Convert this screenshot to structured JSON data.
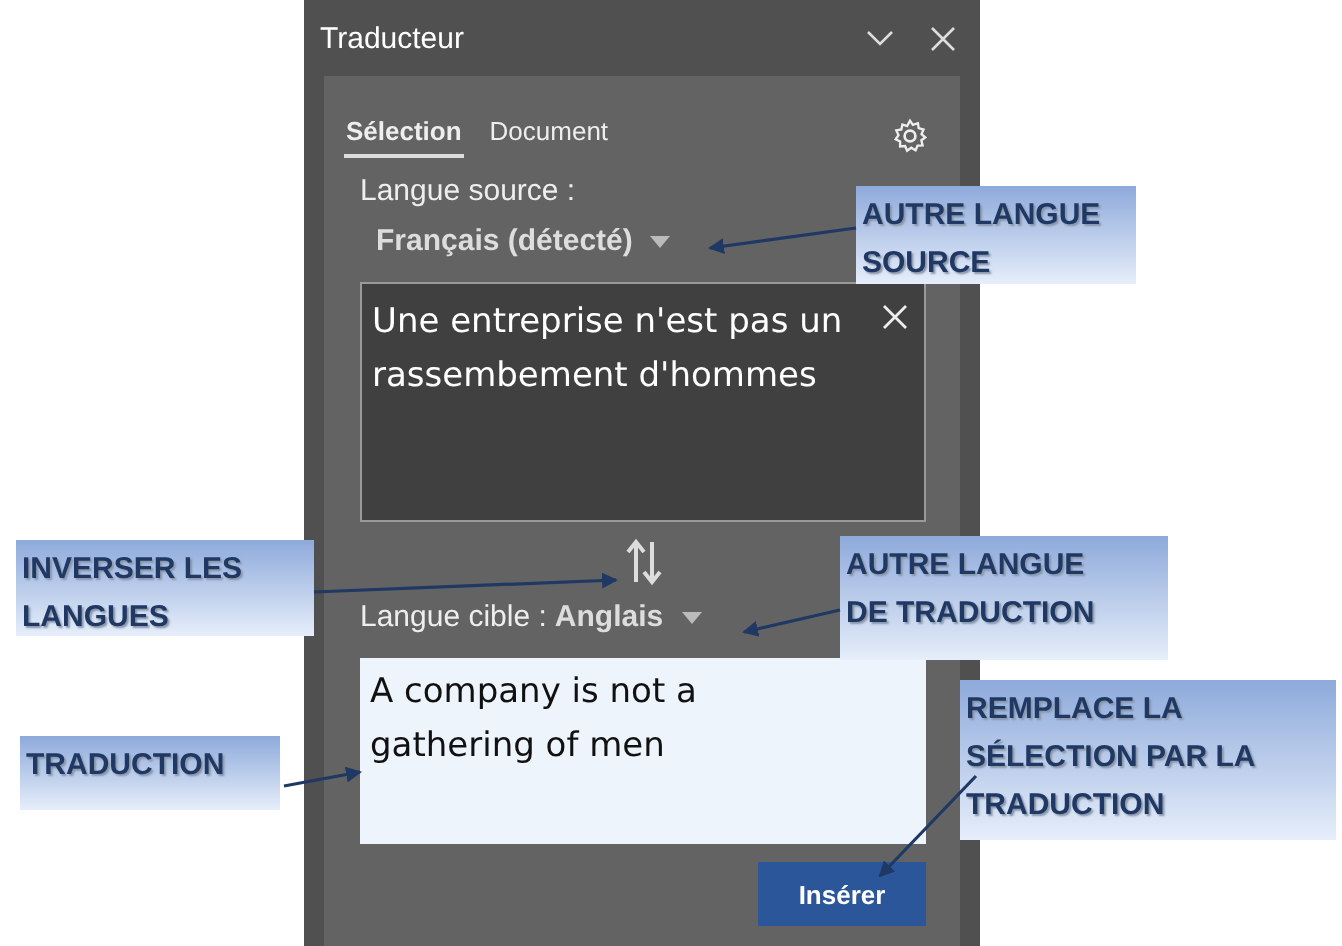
{
  "window": {
    "title": "Traducteur"
  },
  "tabs": [
    {
      "label": "Sélection",
      "selected": true
    },
    {
      "label": "Document",
      "selected": false
    }
  ],
  "source": {
    "label": "Langue source :",
    "language": "Français (détecté)",
    "text": "Une entreprise n'est pas un rassembement d'hommes"
  },
  "target": {
    "label": "Langue cible :",
    "language": "Anglais",
    "text": "A company is not a gathering of men"
  },
  "insert_button": "Insérer",
  "annotations": [
    {
      "text": "AUTRE LANGUE SOURCE"
    },
    {
      "text": "INVERSER LES LANGUES"
    },
    {
      "text": "AUTRE LANGUE DE TRADUCTION"
    },
    {
      "text": "TRADUCTION"
    },
    {
      "text": "REMPLACE LA SÉLECTION PAR LA TRADUCTION"
    }
  ]
}
